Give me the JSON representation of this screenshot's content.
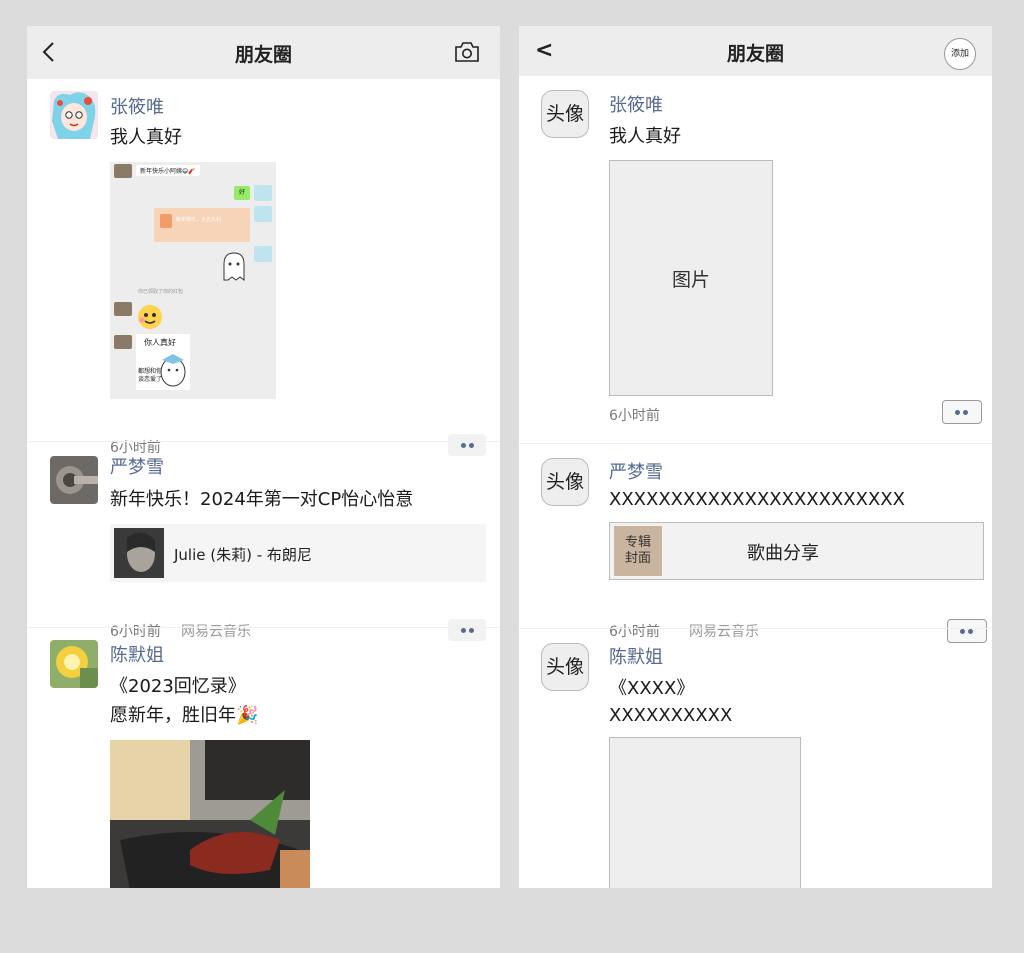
{
  "left": {
    "header": {
      "title": "朋友圈"
    },
    "posts": [
      {
        "name": "张筱唯",
        "text": "我人真好",
        "time": "6小时前",
        "screenshot": {
          "msg1": "新年快乐小阿姨😄🧨",
          "reply": "好",
          "redpacket": "新年快乐，大吉大利",
          "note": "你已领取了你的红包",
          "sticker_caption1": "你人真好",
          "sticker_caption2": "都想和你谈恋爱了"
        }
      },
      {
        "name": "严梦雪",
        "text": "新年快乐！2024年第一对CP怡心怡意",
        "music": "Julie (朱莉) - 布朗尼",
        "time": "6小时前",
        "source": "网易云音乐"
      },
      {
        "name": "陈默姐",
        "text_line1": "《2023回忆录》",
        "text_line2": "愿新年，胜旧年🎉"
      }
    ]
  },
  "right": {
    "header": {
      "back": "<",
      "title": "朋友圈",
      "add": "添加"
    },
    "posts": [
      {
        "avatar": "头像",
        "name": "张筱唯",
        "text": "我人真好",
        "image_label": "图片",
        "time": "6小时前"
      },
      {
        "avatar": "头像",
        "name": "严梦雪",
        "text": "XXXXXXXXXXXXXXXXXXXXXXXX",
        "cover": "专辑封面",
        "cover_line1": "专辑",
        "cover_line2": "封面",
        "music": "歌曲分享",
        "time": "6小时前",
        "source": "网易云音乐"
      },
      {
        "avatar": "头像",
        "name": "陈默姐",
        "text_line1": "《XXXX》",
        "text_line2": "XXXXXXXXXX"
      }
    ]
  }
}
